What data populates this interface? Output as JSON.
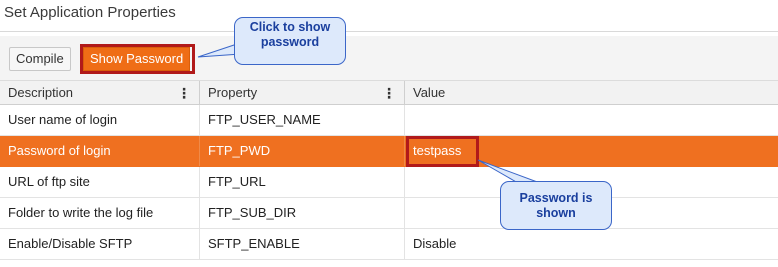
{
  "page_title": "Set Application Properties",
  "toolbar": {
    "compile_label": "Compile",
    "show_password_label": "Show Password"
  },
  "columns": [
    {
      "label": "Description",
      "menu": "⋮"
    },
    {
      "label": "Property",
      "menu": "⋮"
    },
    {
      "label": "Value"
    }
  ],
  "rows": [
    {
      "description": "User name of login",
      "property": "FTP_USER_NAME",
      "value": ""
    },
    {
      "description": "Password of login",
      "property": "FTP_PWD",
      "value": "testpass",
      "selected": true
    },
    {
      "description": "URL of ftp site",
      "property": "FTP_URL",
      "value": ""
    },
    {
      "description": "Folder to write the log file",
      "property": "FTP_SUB_DIR",
      "value": ""
    },
    {
      "description": "Enable/Disable SFTP",
      "property": "SFTP_ENABLE",
      "value": "Disable"
    }
  ],
  "callouts": {
    "show_password": "Click to show password",
    "password_shown": "Password is shown"
  },
  "colors": {
    "accent": "#ef7020",
    "highlight_border": "#b11a1a",
    "callout_fill": "#dde9fb",
    "callout_border": "#3b66c8"
  }
}
